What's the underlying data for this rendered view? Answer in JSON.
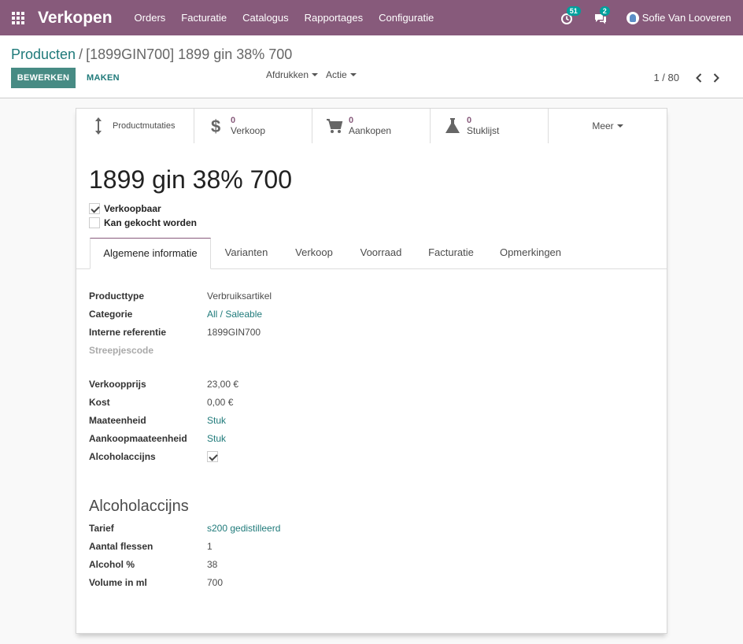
{
  "navbar": {
    "brand": "Verkopen",
    "menu": [
      "Orders",
      "Facturatie",
      "Catalogus",
      "Rapportages",
      "Configuratie"
    ],
    "activity_count": "51",
    "message_count": "2",
    "user_name": "Sofie Van Looveren"
  },
  "control": {
    "breadcrumb_parent": "Producten",
    "breadcrumb_separator": "/",
    "breadcrumb_current": "[1899GIN700] 1899 gin 38% 700",
    "edit_label": "BEWERKEN",
    "create_label": "MAKEN",
    "print_label": "Afdrukken",
    "action_label": "Actie",
    "pager_value": "1 / 80"
  },
  "stats": {
    "moves_label": "Productmutaties",
    "sales_value": "0",
    "sales_label": "Verkoop",
    "purchases_value": "0",
    "purchases_label": "Aankopen",
    "bom_value": "0",
    "bom_label": "Stuklijst",
    "more_label": "Meer"
  },
  "product": {
    "name": "1899 gin 38% 700",
    "can_be_sold_label": "Verkoopbaar",
    "can_be_sold": true,
    "can_be_purchased_label": "Kan gekocht worden",
    "can_be_purchased": false
  },
  "tabs": [
    "Algemene informatie",
    "Varianten",
    "Verkoop",
    "Voorraad",
    "Facturatie",
    "Opmerkingen"
  ],
  "general": {
    "type_label": "Producttype",
    "type_value": "Verbruiksartikel",
    "category_label": "Categorie",
    "category_value": "All / Saleable",
    "ref_label": "Interne referentie",
    "ref_value": "1899GIN700",
    "barcode_label": "Streepjescode",
    "price_label": "Verkoopprijs",
    "price_value": "23,00 €",
    "cost_label": "Kost",
    "cost_value": "0,00 €",
    "uom_label": "Maateenheid",
    "uom_value": "Stuk",
    "purchase_uom_label": "Aankoopmaateenheid",
    "purchase_uom_value": "Stuk",
    "excise_label": "Alcoholaccijns",
    "excise_checked": true
  },
  "excise": {
    "title": "Alcoholaccijns",
    "tariff_label": "Tarief",
    "tariff_value": "s200 gedistilleerd",
    "bottles_label": "Aantal flessen",
    "bottles_value": "1",
    "alcohol_label": "Alcohol %",
    "alcohol_value": "38",
    "volume_label": "Volume in ml",
    "volume_value": "700"
  },
  "colors": {
    "brand": "#875a7b",
    "accent": "#478b84",
    "link": "#1f7a7a",
    "badge": "#00a09d"
  }
}
